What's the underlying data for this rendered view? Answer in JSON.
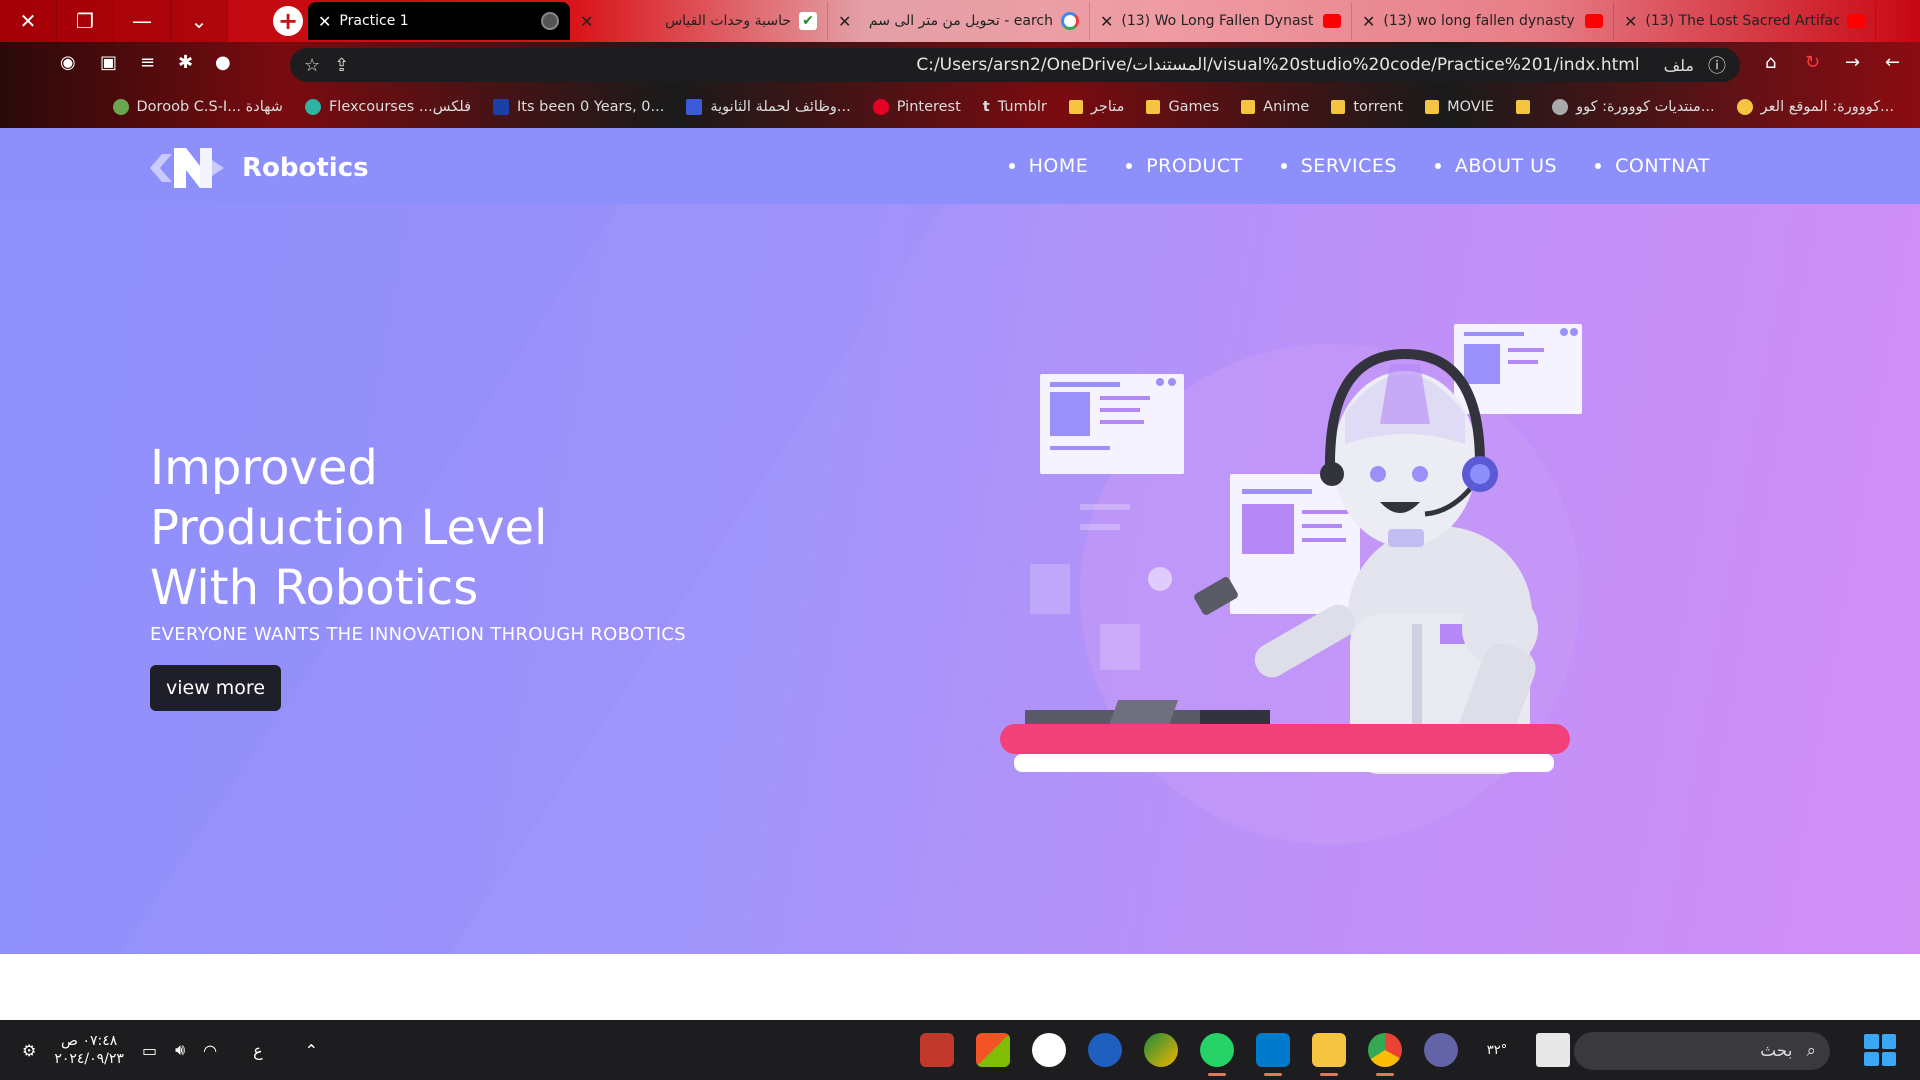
{
  "browser": {
    "tabs": [
      {
        "title": "Practice 1",
        "active": true,
        "icon": "globe-icon"
      },
      {
        "title": "حاسبة وحدات القياس",
        "icon": "check-icon"
      },
      {
        "title": "تحويل من متر الى سم - earch",
        "icon": "google-icon"
      },
      {
        "title": "(13) Wo Long Fallen Dynast",
        "icon": "youtube-icon"
      },
      {
        "title": "(13) wo long fallen dynasty",
        "icon": "youtube-icon"
      },
      {
        "title": "(13) The Lost Sacred Artifac",
        "icon": "youtube-icon"
      }
    ],
    "address_prefix": "ملف",
    "address_url": "C:/Users/arsn2/OneDrive/المستندات/visual%20studio%20code/Practice%201/indx.html",
    "bookmarks": [
      "كووورة: الموقع العر...",
      "منتديات كووورة: كوو...",
      "MOVIE",
      "torrent",
      "Anime",
      "Games",
      "متاجر",
      "Tumblr",
      "Pinterest",
      "وظائف لحملة الثانوية...",
      "Its been 0 Years, 0...",
      "Flexcourses ...فلكس",
      "Doroob C.S-I... شهادة"
    ]
  },
  "site": {
    "brand": "Robotics",
    "nav": [
      "HOME",
      "PRODUCT",
      "SERVICES",
      "ABOUT US",
      "CONTNAT"
    ],
    "hero": {
      "headline_lines": [
        "Improved",
        "Production Level",
        "With Robotics"
      ],
      "subline": "EVERYONE WANTS THE INNOVATION THROUGH ROBOTICS",
      "cta": "view more"
    },
    "colors": {
      "nav_bg": "#8d90fb",
      "hero_start": "#8e90fb",
      "hero_end": "#cf88f6",
      "cta_bg": "#1f1f29",
      "desk_stripe": "#f2407a"
    }
  },
  "taskbar": {
    "time": "٠٧:٤٨ ص",
    "date": "٢٠٢٤/٠٩/٢٣",
    "lang": "ع",
    "weather": "٣٢°",
    "search_label": "بحث"
  }
}
